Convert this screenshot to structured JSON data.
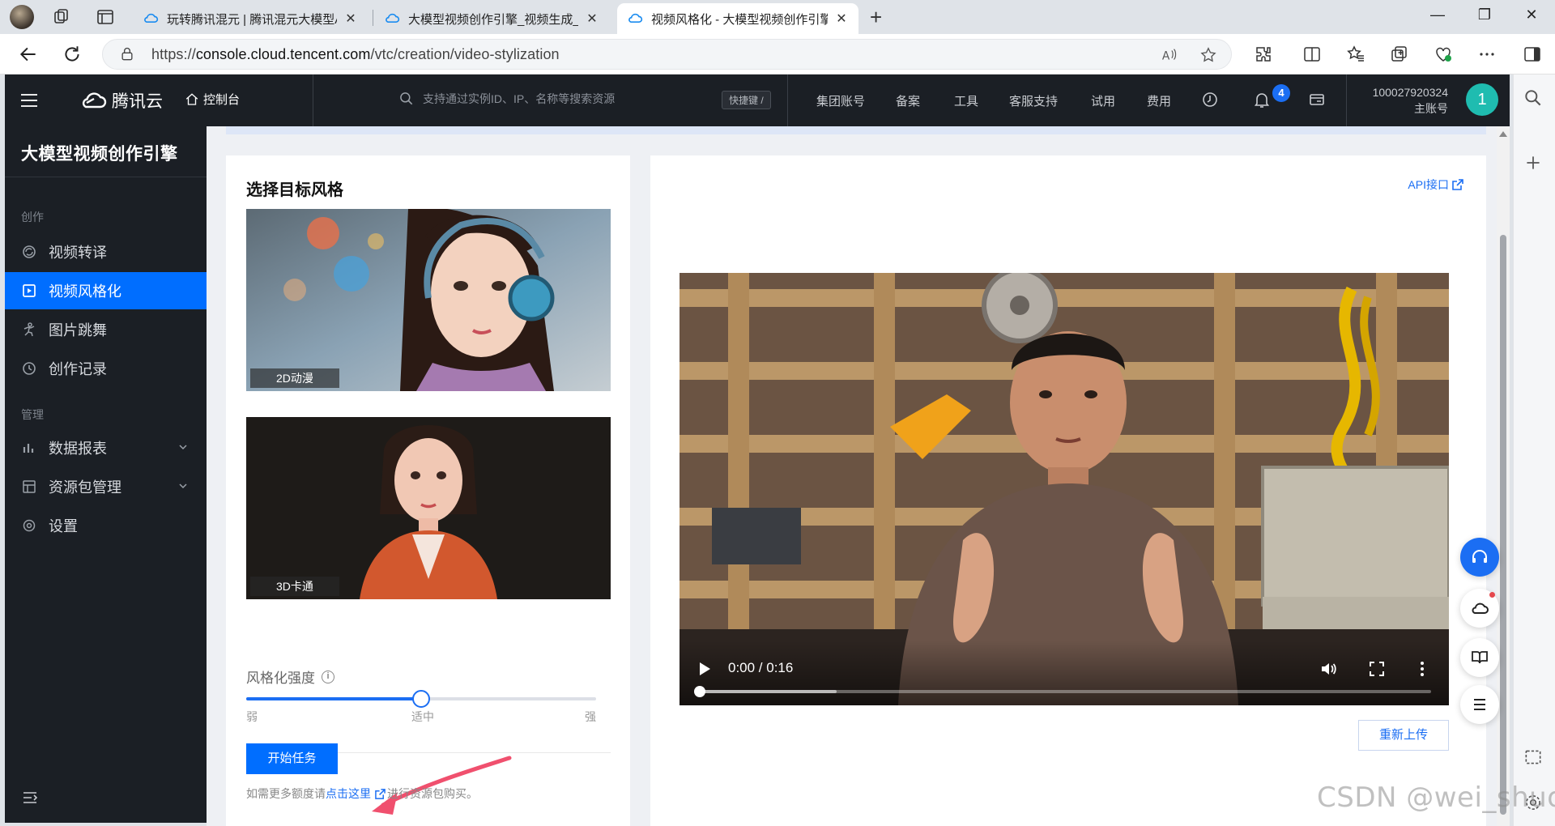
{
  "browser": {
    "tabs": [
      {
        "title": "玩转腾讯混元 | 腾讯混元大模型AI",
        "active": false
      },
      {
        "title": "大模型视频创作引擎_视频生成_视",
        "active": false
      },
      {
        "title": "视频风格化 - 大模型视频创作引擎",
        "active": true
      }
    ],
    "url_prefix": "https://",
    "url_host": "console.cloud.tencent.com",
    "url_path": "/vtc/creation/video-stylization"
  },
  "topnav": {
    "brand": "腾讯云",
    "console": "控制台",
    "search_placeholder": "支持通过实例ID、IP、名称等搜索资源",
    "shortcut": "快捷键 /",
    "links": [
      "集团账号",
      "备案",
      "工具",
      "客服支持",
      "试用",
      "费用"
    ],
    "notification_count": "4",
    "account_id": "100027920324",
    "account_role": "主账号",
    "avatar_letter": "1"
  },
  "sidebar": {
    "title": "大模型视频创作引擎",
    "group_create": "创作",
    "group_manage": "管理",
    "items": [
      {
        "label": "视频转译",
        "active": false
      },
      {
        "label": "视频风格化",
        "active": true
      },
      {
        "label": "图片跳舞",
        "active": false
      },
      {
        "label": "创作记录",
        "active": false
      },
      {
        "label": "数据报表",
        "active": false
      },
      {
        "label": "资源包管理",
        "active": false
      },
      {
        "label": "设置",
        "active": false
      }
    ]
  },
  "left_panel": {
    "title": "选择目标风格",
    "styles": [
      {
        "label": "2D动漫",
        "selected": true
      },
      {
        "label": "3D卡通",
        "selected": false
      }
    ],
    "strength_label": "风格化强度",
    "strength_value": 0.5,
    "ticks": [
      "弱",
      "适中",
      "强"
    ],
    "start_button": "开始任务",
    "quota_prefix": "如需更多额度请",
    "quota_link": "点击这里",
    "quota_suffix": "进行资源包购买。"
  },
  "right_panel": {
    "api_link": "API接口",
    "video_time": "0:00 / 0:16",
    "reupload": "重新上传"
  },
  "watermark": "CSDN @wei_shuo",
  "colors": {
    "accent": "#006eff",
    "nav_bg": "#1b1f25",
    "page_bg": "#eef0f4"
  }
}
